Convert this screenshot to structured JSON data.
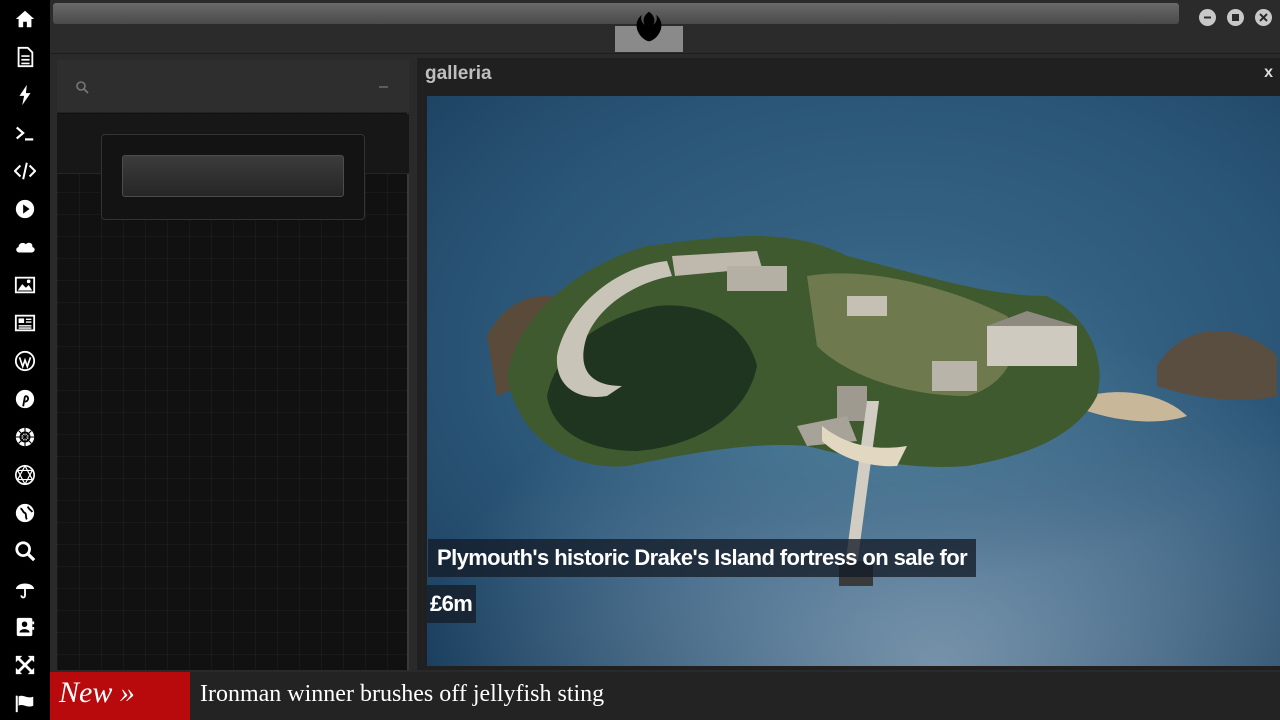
{
  "sidebar": {
    "icons": [
      "home-icon",
      "document-icon",
      "lightning-icon",
      "terminal-icon",
      "code-icon",
      "play-icon",
      "cloud-icon",
      "image-icon",
      "newspaper-icon",
      "wordpress-icon",
      "pinterest-icon",
      "rebel-alliance-icon",
      "network-sphere-icon",
      "globe-icon",
      "search-icon",
      "umbrella-icon",
      "contacts-icon",
      "expand-arrows-icon",
      "flag-icon"
    ]
  },
  "search_panel": {
    "collapse_label": "–",
    "search_placeholder": ""
  },
  "galleria": {
    "title": "galleria",
    "close_label": "x",
    "caption_line1": "Plymouth's historic Drake's Island fortress on sale for",
    "caption_line2": "£6m"
  },
  "ticker": {
    "badge": "New »",
    "headline": "Ironman winner brushes off jellyfish sting"
  },
  "colors": {
    "sidebar_bg": "#000000",
    "ticker_badge": "#b8090d",
    "panel_bg": "#202020"
  }
}
